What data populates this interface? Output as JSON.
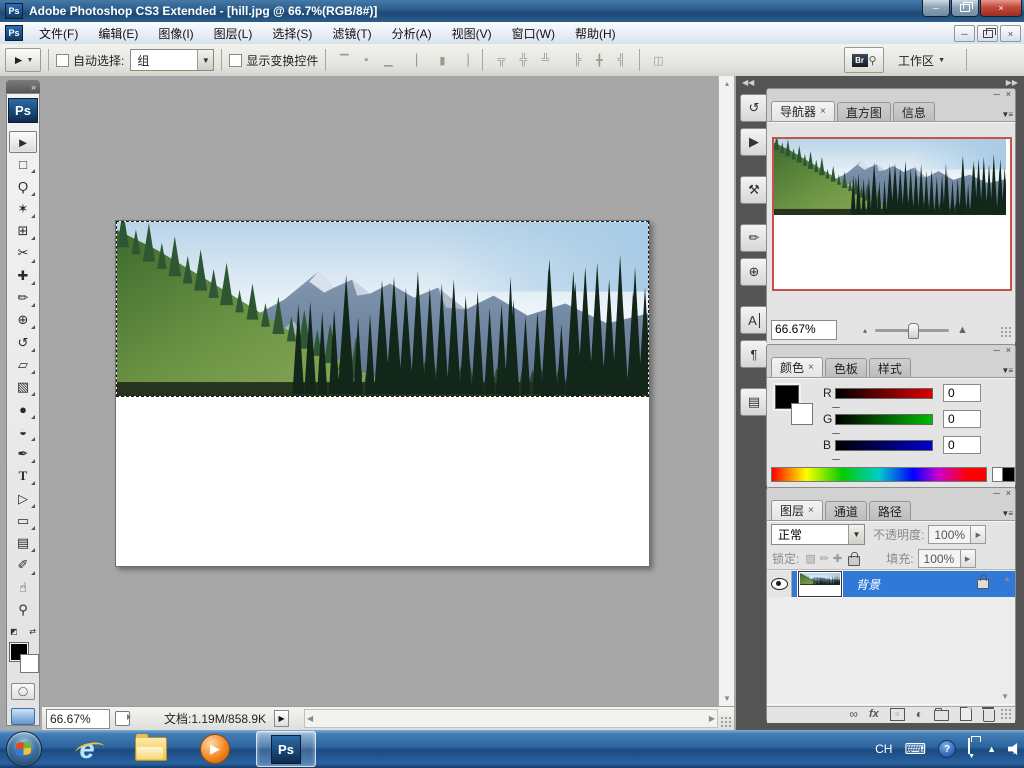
{
  "colors": {
    "titlebar_blue": "#2e608f",
    "taskbar_blue": "#2c649e",
    "selection_blue": "#3079d8",
    "navigator_proxy_red": "#c5524b",
    "ps_logo_blue": "#0d2b4d",
    "workarea_gray": "#a7a7a7"
  },
  "icons": {
    "close": "×",
    "minimize": "─",
    "menu_flyout": "▼≡",
    "dbl_left": "◀◀",
    "dbl_right": "▶▶",
    "up": "▲",
    "down": "▼",
    "left": "◀",
    "right": "▶",
    "small_up": "▴",
    "collapse": "»",
    "caret_down": "▼",
    "swap": "⇄",
    "mini_swatch": "◩"
  },
  "window": {
    "app_icon": "Ps",
    "title": "Adobe Photoshop CS3 Extended - [hill.jpg @ 66.7%(RGB/8#)]"
  },
  "menu": {
    "items": [
      "文件(F)",
      "编辑(E)",
      "图像(I)",
      "图层(L)",
      "选择(S)",
      "滤镜(T)",
      "分析(A)",
      "视图(V)",
      "窗口(W)",
      "帮助(H)"
    ]
  },
  "options": {
    "auto_select_label": "自动选择:",
    "auto_select_value": "组",
    "show_transform_label": "显示变换控件",
    "bridge_label": "Br",
    "workspace_label": "工作区",
    "align_icons": [
      {
        "name": "align-top",
        "glyph": "▔"
      },
      {
        "name": "align-vcenter",
        "glyph": "▪"
      },
      {
        "name": "align-bottom",
        "glyph": "▁"
      },
      {
        "name": "align-left",
        "glyph": "▏"
      },
      {
        "name": "align-hcenter",
        "glyph": "▮"
      },
      {
        "name": "align-right",
        "glyph": "▕"
      },
      {
        "name": "distribute-top",
        "glyph": "╦"
      },
      {
        "name": "distribute-vcenter",
        "glyph": "╬"
      },
      {
        "name": "distribute-bottom",
        "glyph": "╩"
      },
      {
        "name": "distribute-left",
        "glyph": "╠"
      },
      {
        "name": "distribute-hcenter",
        "glyph": "╋"
      },
      {
        "name": "distribute-right",
        "glyph": "╣"
      },
      {
        "name": "auto-align-layers",
        "glyph": "◫"
      }
    ]
  },
  "toolbox": {
    "logo": "Ps",
    "tools": [
      {
        "name": "move-tool",
        "glyph": "►"
      },
      {
        "name": "marquee-tool",
        "glyph": "□"
      },
      {
        "name": "lasso-tool",
        "glyph": "Ϙ"
      },
      {
        "name": "quick-selection-tool",
        "glyph": "✶"
      },
      {
        "name": "crop-tool",
        "glyph": "⊞"
      },
      {
        "name": "slice-tool",
        "glyph": "✂"
      },
      {
        "name": "healing-brush-tool",
        "glyph": "✚"
      },
      {
        "name": "brush-tool",
        "glyph": "✏"
      },
      {
        "name": "clone-stamp-tool",
        "glyph": "⊕"
      },
      {
        "name": "history-brush-tool",
        "glyph": "↺"
      },
      {
        "name": "eraser-tool",
        "glyph": "▱"
      },
      {
        "name": "gradient-tool",
        "glyph": "▧"
      },
      {
        "name": "blur-tool",
        "glyph": "●"
      },
      {
        "name": "dodge-tool",
        "glyph": "◒"
      },
      {
        "name": "pen-tool",
        "glyph": "✒"
      },
      {
        "name": "type-tool",
        "glyph": "T"
      },
      {
        "name": "path-select-tool",
        "glyph": "▷"
      },
      {
        "name": "shape-tool",
        "glyph": "▭"
      },
      {
        "name": "notes-tool",
        "glyph": "▤"
      },
      {
        "name": "eyedropper-tool",
        "glyph": "✐"
      },
      {
        "name": "hand-tool",
        "glyph": "☝"
      },
      {
        "name": "zoom-tool",
        "glyph": "⚲"
      }
    ]
  },
  "dock": {
    "buttons": [
      {
        "name": "history-panel",
        "glyph": "↺"
      },
      {
        "name": "actions-panel",
        "glyph": "▶"
      },
      {
        "name": "tool-presets-panel",
        "glyph": "⚒"
      },
      {
        "name": "brushes-panel",
        "glyph": "✏"
      },
      {
        "name": "clone-source-panel",
        "glyph": "⊕"
      },
      {
        "name": "character-panel",
        "glyph": "A"
      },
      {
        "name": "paragraph-panel",
        "glyph": "¶"
      },
      {
        "name": "layer-comps-panel",
        "glyph": "▤"
      }
    ]
  },
  "document": {
    "zoom": "66.67%",
    "info": "文档:1.19M/858.9K"
  },
  "panels": {
    "navigator": {
      "tabs": [
        "导航器",
        "直方图",
        "信息"
      ],
      "zoom": "66.67%"
    },
    "color": {
      "tabs": [
        "颜色",
        "色板",
        "样式"
      ],
      "channels": [
        {
          "label": "R",
          "value": "0"
        },
        {
          "label": "G",
          "value": "0"
        },
        {
          "label": "B",
          "value": "0"
        }
      ]
    },
    "layers": {
      "tabs": [
        "图层",
        "通道",
        "路径"
      ],
      "blend_mode": "正常",
      "opacity_label": "不透明度:",
      "opacity_value": "100%",
      "lock_label": "锁定:",
      "fill_label": "填充:",
      "fill_value": "100%",
      "layer_name": "背景",
      "fx_label": "fx"
    }
  },
  "taskbar": {
    "ps_label": "Ps",
    "ie_label": "e",
    "tray_lang": "CH",
    "help_label": "?"
  }
}
